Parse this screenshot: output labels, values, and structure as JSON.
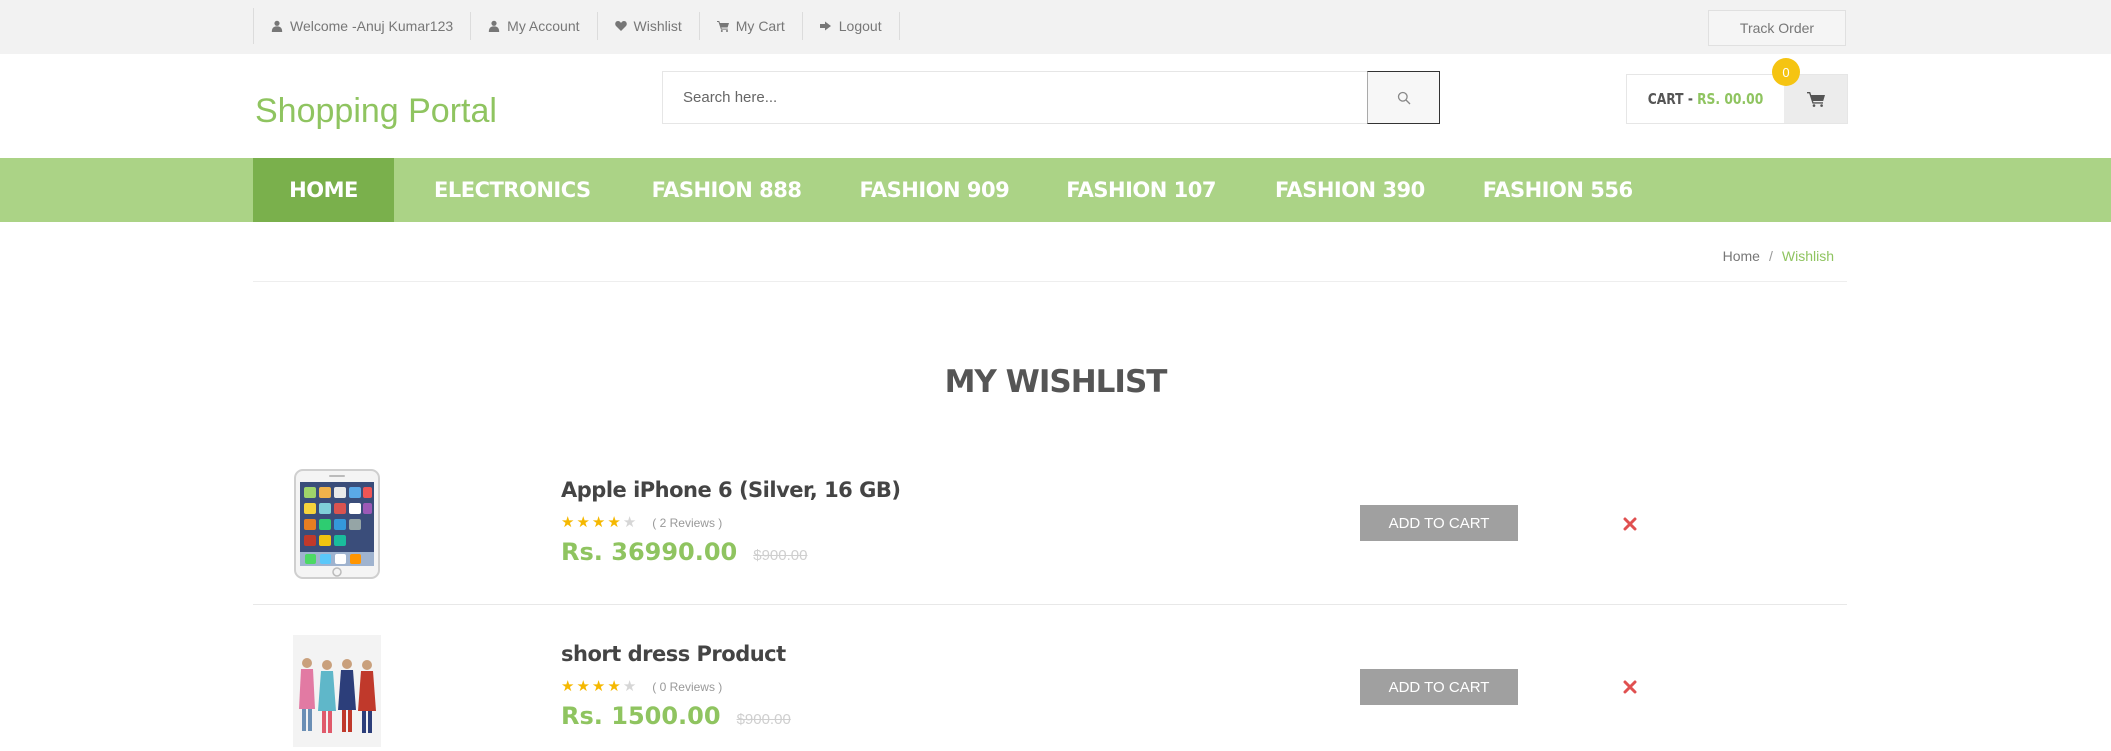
{
  "topbar": {
    "links": [
      {
        "label": "Welcome -Anuj Kumar123",
        "icon": "user-icon"
      },
      {
        "label": "My Account",
        "icon": "user-icon"
      },
      {
        "label": "Wishlist",
        "icon": "heart-icon"
      },
      {
        "label": "My Cart",
        "icon": "cart-icon"
      },
      {
        "label": "Logout",
        "icon": "logout-icon"
      }
    ],
    "track_order": "Track Order"
  },
  "header": {
    "logo": "Shopping Portal",
    "search_placeholder": "Search here...",
    "cart_label": "CART -",
    "cart_amount": "RS. 00.00",
    "cart_count": "0"
  },
  "nav": {
    "items": [
      "HOME",
      "ELECTRONICS",
      "FASHION 888",
      "FASHION 909",
      "FASHION 107",
      "FASHION 390",
      "FASHION 556"
    ],
    "active_index": 0
  },
  "breadcrumb": {
    "home": "Home",
    "separator": "/",
    "current": "Wishlish"
  },
  "wishlist": {
    "title": "MY WISHLIST",
    "items": [
      {
        "name": "Apple iPhone 6 (Silver, 16 GB)",
        "rating": 4,
        "reviews": "( 2 Reviews )",
        "price": "Rs. 36990.00",
        "old_price": "$900.00",
        "button": "ADD TO CART"
      },
      {
        "name": "short dress Product",
        "rating": 4,
        "reviews": "( 0 Reviews )",
        "price": "Rs. 1500.00",
        "old_price": "$900.00",
        "button": "ADD TO CART"
      }
    ]
  },
  "colors": {
    "brand_green": "#8fc460",
    "nav_green": "#abd386",
    "nav_active": "#7ab04c",
    "badge_yellow": "#f5c412",
    "remove_red": "#e05050"
  }
}
